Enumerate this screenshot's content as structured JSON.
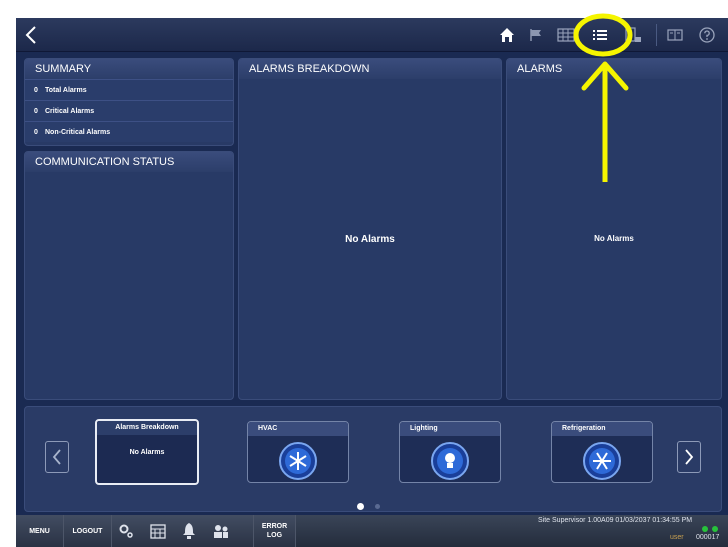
{
  "toolbar": {
    "back_icon": "chevron-left-icon",
    "icons": [
      "home-icon",
      "flag-icon",
      "grid-icon",
      "list-icon",
      "report-icon",
      "book-icon",
      "help-icon"
    ]
  },
  "summary": {
    "title": "SUMMARY",
    "rows": [
      {
        "count": "0",
        "label": "Total Alarms"
      },
      {
        "count": "0",
        "label": "Critical Alarms"
      },
      {
        "count": "0",
        "label": "Non-Critical Alarms"
      }
    ]
  },
  "communication": {
    "title": "COMMUNICATION STATUS"
  },
  "breakdown": {
    "title": "ALARMS BREAKDOWN",
    "message": "No Alarms"
  },
  "alarms": {
    "title": "ALARMS",
    "message": "No Alarms"
  },
  "carousel": {
    "tiles": [
      {
        "title": "Alarms Breakdown",
        "message": "No Alarms"
      },
      {
        "title": "HVAC",
        "icon": "hvac-icon"
      },
      {
        "title": "Lighting",
        "icon": "lighting-icon"
      },
      {
        "title": "Refrigeration",
        "icon": "refrigeration-icon"
      }
    ]
  },
  "bottombar": {
    "menu": "MENU",
    "logout": "LOGOUT",
    "error_log_line1": "ERROR",
    "error_log_line2": "LOG",
    "version": "Site Supervisor 1.00A09 01/03/2037 01:34:55 PM",
    "user": "user",
    "user_id": "000017"
  },
  "colors": {
    "background": "#1a2a52",
    "panel": "#283a66",
    "annotation": "#f5f500",
    "status_green": "#27c23b"
  }
}
